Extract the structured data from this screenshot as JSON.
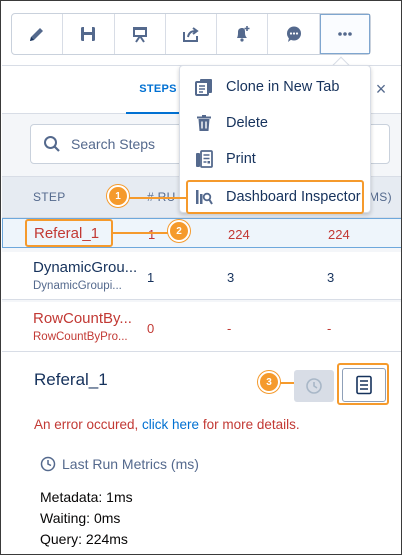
{
  "toolbar": {
    "buttons": [
      {
        "icon": "pencil-icon"
      },
      {
        "icon": "save-icon"
      },
      {
        "icon": "presentation-icon"
      },
      {
        "icon": "share-icon"
      },
      {
        "icon": "bell-add-icon"
      },
      {
        "icon": "chat-icon"
      },
      {
        "icon": "more-icon"
      }
    ]
  },
  "panel": {
    "tab_label": "STEPS",
    "close_glyph": "×"
  },
  "search": {
    "placeholder": "Search Steps"
  },
  "table": {
    "headers": {
      "step": "STEP",
      "rows": "# RU",
      "time": "MS)"
    },
    "rows": [
      {
        "name": "Referal_1",
        "sub": "",
        "rows": "1",
        "time1": "224",
        "time2": "224",
        "error": true
      },
      {
        "name": "DynamicGrou...",
        "sub": "DynamicGroupi...",
        "rows": "1",
        "time1": "3",
        "time2": "3",
        "error": false
      },
      {
        "name": "RowCountBy...",
        "sub": "RowCountByPro...",
        "rows": "0",
        "time1": "-",
        "time2": "-",
        "error": true
      }
    ]
  },
  "menu": {
    "items": [
      {
        "label": "Clone in New Tab",
        "icon": "clone-icon"
      },
      {
        "label": "Delete",
        "icon": "trash-icon"
      },
      {
        "label": "Print",
        "icon": "print-icon"
      },
      {
        "label": "Dashboard Inspector",
        "icon": "inspector-icon"
      }
    ]
  },
  "details": {
    "title": "Referal_1",
    "error_prefix": "An error occured, ",
    "error_link": "click here",
    "error_suffix": " for more details.",
    "metrics_title": "Last Run Metrics (ms)",
    "metrics": [
      "Metadata: 1ms",
      "Waiting: 0ms",
      "Query: 224ms"
    ]
  },
  "callouts": [
    "1",
    "2",
    "3"
  ],
  "colors": {
    "accent": "#0070d2",
    "error": "#c23934",
    "callout": "#f59a2c"
  }
}
